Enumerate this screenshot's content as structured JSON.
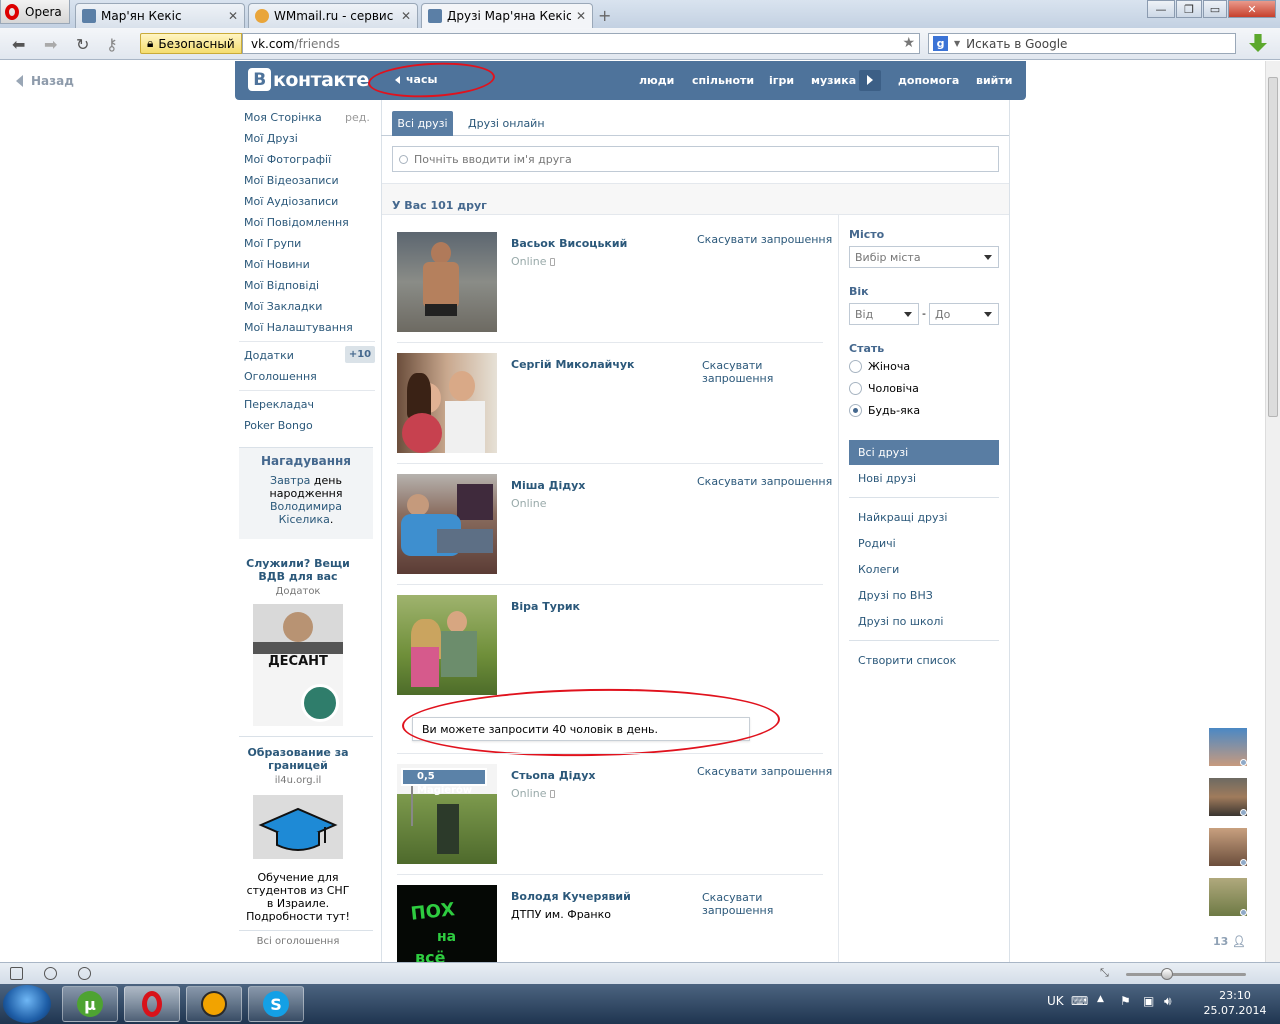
{
  "browser": {
    "opera_label": "Opera",
    "tabs": [
      {
        "title": "Мар'ян Кекіс",
        "close": "✕",
        "active": false
      },
      {
        "title": "WMmail.ru - сервис п...",
        "close": "✕",
        "active": false
      },
      {
        "title": "Друзі Мар'яна Кекіса |...",
        "close": "✕",
        "active": true
      }
    ],
    "new_tab": "+",
    "security_label": "Безопасный",
    "url_host": "vk.com",
    "url_path": "/friends",
    "search_placeholder": "Искать в Google",
    "search_engine_letter": "g"
  },
  "page": {
    "back_label": "Назад",
    "header": {
      "logo": "контакте",
      "logo_letter": "В",
      "clock_label": "часы",
      "nav": [
        "люди",
        "спільноти",
        "ігри",
        "музика",
        "допомога",
        "вийти"
      ]
    },
    "left_menu": {
      "items": [
        "Моя Сторінка",
        "Мої Друзі",
        "Мої Фотографії",
        "Мої Відеозаписи",
        "Мої Аудіозаписи",
        "Мої Повідомлення",
        "Мої Групи",
        "Мої Новини",
        "Мої Відповіді",
        "Мої Закладки",
        "Мої Налаштування"
      ],
      "edit_label": "ред.",
      "apps_label": "Додатки",
      "apps_badge": "+10",
      "ads_label": "Оголошення",
      "extra": [
        "Перекладач",
        "Poker Bongo"
      ]
    },
    "reminder": {
      "title": "Нагадування",
      "text_1": "Завтра",
      "text_2": " день народження ",
      "text_link": "Володимира Кіселика",
      "text_3": "."
    },
    "ads": [
      {
        "title": "Служили? Вещи ВДВ для вас",
        "sub": "Додаток",
        "image_text": "ДЕСАНТ"
      },
      {
        "title": "Образование за границей",
        "sub": "il4u.org.il",
        "text": "Обучение для студентов из СНГ в Израиле. Подробности тут!"
      }
    ],
    "all_ads_label": "Всі оголошення",
    "tabs": {
      "all": "Всі друзі",
      "online": "Друзі онлайн"
    },
    "search_placeholder": "Почніть вводити ім'я друга",
    "friends_count": "У Вас 101 друг",
    "friends": [
      {
        "name": "Васьок Висоцький",
        "sub": "Online",
        "mobile": true,
        "action": "Скасувати запрошення"
      },
      {
        "name": "Сергій Миколайчук",
        "sub": "",
        "mobile": false,
        "action": "Скасувати запрошення"
      },
      {
        "name": "Міша Дідух",
        "sub": "Online",
        "mobile": false,
        "action": "Скасувати запрошення"
      },
      {
        "name": "Віра Турик",
        "sub": "",
        "mobile": false,
        "action": ""
      },
      {
        "name": "Стьопа Дідух",
        "sub": "Online",
        "mobile": true,
        "action": "Скасувати запрошення",
        "photo_sign": "0,5 Magierów"
      },
      {
        "name": "Володя Кучерявий",
        "sub": "ДТПУ им. Франко",
        "mobile": false,
        "action": "Скасувати запрошення"
      }
    ],
    "notice": "Ви можете запросити 40 чоловік в день.",
    "filters": {
      "city_label": "Місто",
      "city_select": "Вибір міста",
      "age_label": "Вік",
      "age_from": "Від",
      "age_dash": "-",
      "age_to": "До",
      "sex_label": "Стать",
      "sex_options": [
        "Жіноча",
        "Чоловіча",
        "Будь-яка"
      ],
      "sex_selected": "Будь-яка",
      "lists_active": "Всі друзі",
      "lists": [
        "Нові друзі",
        "Найкращі друзі",
        "Родичі",
        "Колеги",
        "Друзі по ВНЗ",
        "Друзі по школі",
        "Створити список"
      ]
    },
    "online_strip_count": "13"
  },
  "taskbar": {
    "lang": "UK",
    "time": "23:10",
    "date": "25.07.2014"
  },
  "colors": {
    "vk_blue": "#4e739b",
    "link": "#2b587a",
    "active_tab": "#597da3",
    "annotation_red": "#e0121d"
  }
}
